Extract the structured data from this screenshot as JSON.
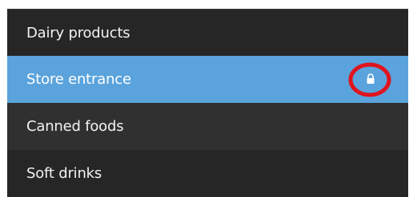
{
  "list": {
    "items": [
      {
        "label": "Dairy products",
        "selected": false,
        "locked": false
      },
      {
        "label": "Store entrance",
        "selected": true,
        "locked": true
      },
      {
        "label": "Canned foods",
        "selected": false,
        "locked": false
      },
      {
        "label": "Soft drinks",
        "selected": false,
        "locked": false
      }
    ]
  },
  "icons": {
    "lock": "lock-icon",
    "highlight": "highlight-circle"
  },
  "colors": {
    "row_dark": "#262626",
    "row_alt": "#303030",
    "selected": "#5aa3dc",
    "highlight_ring": "#e0141e",
    "text": "#f2f2f2"
  }
}
